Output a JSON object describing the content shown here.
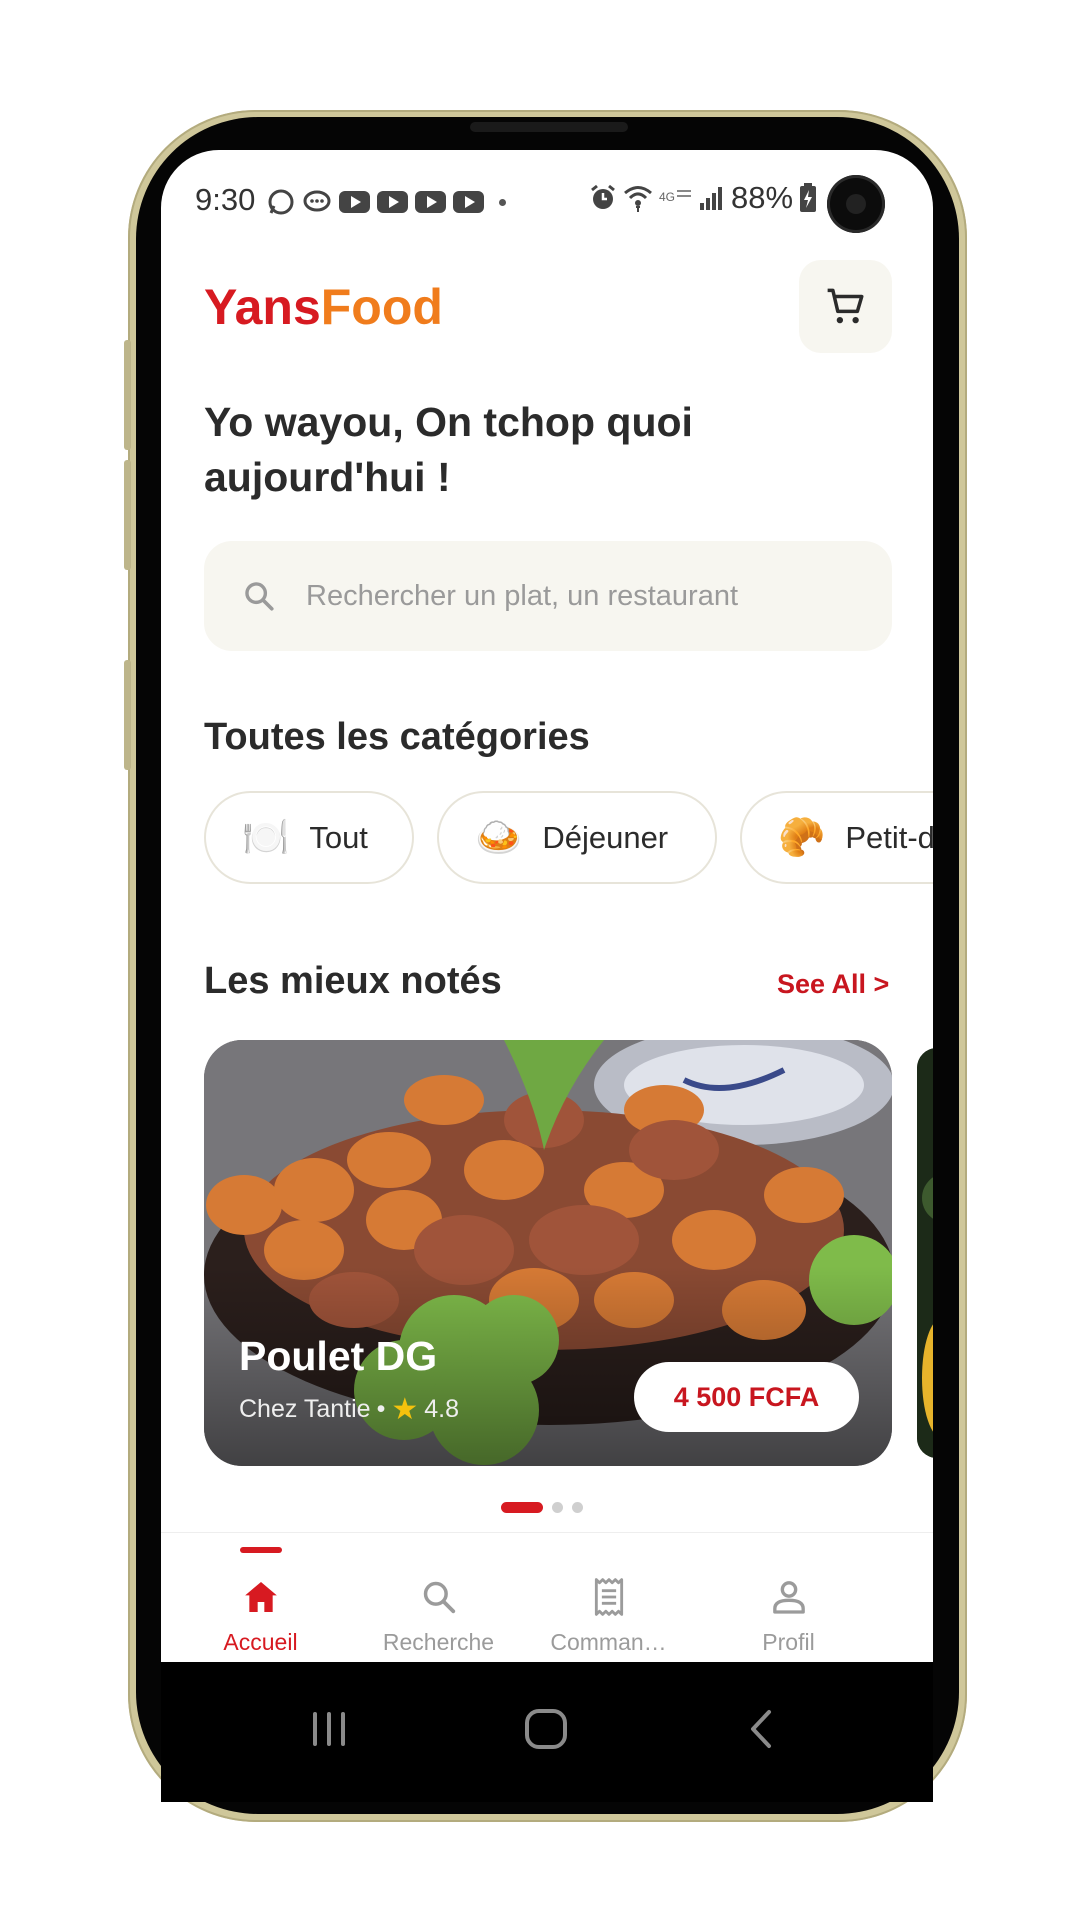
{
  "status_bar": {
    "time": "9:30",
    "battery": "88%"
  },
  "app": {
    "logo_part1": "Yans",
    "logo_part2": "Food",
    "brand_red": "#d71a21",
    "brand_orange": "#f07c1c"
  },
  "header": {
    "greeting": "Yo wayou, On tchop quoi aujourd'hui !",
    "cart_icon": "cart-icon"
  },
  "search": {
    "placeholder": "Rechercher un plat, un restaurant",
    "value": ""
  },
  "categories": {
    "title": "Toutes les catégories",
    "items": [
      {
        "emoji": "🍽️",
        "label": "Tout"
      },
      {
        "emoji": "🍛",
        "label": "Déjeuner"
      },
      {
        "emoji": "🥐",
        "label": "Petit-d"
      }
    ]
  },
  "top_rated": {
    "title": "Les mieux notés",
    "see_all": "See All >",
    "cards": [
      {
        "name": "Poulet DG",
        "restaurant": "Chez Tantie",
        "separator": "•",
        "rating": "4.8",
        "price": "4 500 FCFA"
      }
    ],
    "page_count": 3,
    "active_page": 1
  },
  "bottom_nav": {
    "items": [
      {
        "label": "Accueil",
        "icon": "home-icon",
        "active": true
      },
      {
        "label": "Recherche",
        "icon": "search-icon",
        "active": false
      },
      {
        "label": "Comman…",
        "icon": "receipt-icon",
        "active": false
      },
      {
        "label": "Profil",
        "icon": "person-icon",
        "active": false
      }
    ]
  }
}
